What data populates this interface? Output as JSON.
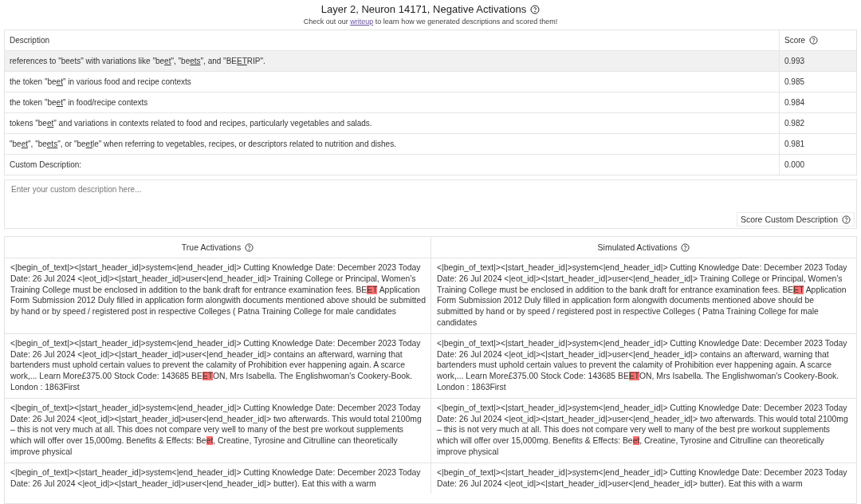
{
  "header": {
    "title": "Layer 2, Neuron 14171, Negative Activations",
    "subtitle_before": "Check out our",
    "subtitle_link": "writeup",
    "subtitle_after": "to learn how we generated descriptions and scored them!"
  },
  "descriptions": {
    "columns": [
      "Description",
      "Score"
    ],
    "rows": [
      {
        "selected": true,
        "score": "0.993",
        "parts": [
          {
            "text": "references to \"beets\" with variations like \"be",
            "underlined": false
          },
          {
            "text": "et",
            "underlined": true
          },
          {
            "text": "\", \"be",
            "underlined": false
          },
          {
            "text": "ets",
            "underlined": true
          },
          {
            "text": "\", and \"BE",
            "underlined": false
          },
          {
            "text": "ET",
            "underlined": true
          },
          {
            "text": "RIP\".",
            "underlined": false
          }
        ]
      },
      {
        "selected": false,
        "score": "0.985",
        "parts": [
          {
            "text": "the token \"be",
            "underlined": false
          },
          {
            "text": "et",
            "underlined": true
          },
          {
            "text": "\" in various food and recipe contexts",
            "underlined": false
          }
        ]
      },
      {
        "selected": false,
        "score": "0.984",
        "parts": [
          {
            "text": "the token \"be",
            "underlined": false
          },
          {
            "text": "et",
            "underlined": true
          },
          {
            "text": "\" in food/recipe contexts",
            "underlined": false
          }
        ]
      },
      {
        "selected": false,
        "score": "0.982",
        "parts": [
          {
            "text": "tokens \"be",
            "underlined": false
          },
          {
            "text": "et",
            "underlined": true
          },
          {
            "text": "\" and variations in contexts related to food and recipes, particularly vegetables and salads.",
            "underlined": false
          }
        ]
      },
      {
        "selected": false,
        "score": "0.981",
        "parts": [
          {
            "text": "\"be",
            "underlined": false
          },
          {
            "text": "et",
            "underlined": true
          },
          {
            "text": "\", \"be",
            "underlined": false
          },
          {
            "text": "ets",
            "underlined": true
          },
          {
            "text": "\", or \"be",
            "underlined": false
          },
          {
            "text": "et",
            "underlined": true
          },
          {
            "text": "le\" when referring to vegetables, recipes, or descriptors related to nutrition and dishes.",
            "underlined": false
          }
        ]
      },
      {
        "selected": false,
        "score": "0.000",
        "parts": [
          {
            "text": "Custom Description:",
            "underlined": false
          }
        ]
      }
    ]
  },
  "custom": {
    "placeholder": "Enter your custom description here...",
    "button": "Score Custom Description"
  },
  "activations": {
    "columns": [
      "True Activations",
      "Simulated Activations"
    ],
    "rows": [
      [
        [
          {
            "text": "<|begin_of_text|><|start_header_id|>system<|end_header_id|> Cutting Knowledge Date: December 2023 Today Date: 26 Jul 2024 <|eot_id|><|start_header_id|>user<|end_header_id|> Training College or Principal, Women’s Training College must be enclosed in addition to the bank draft for entrance examination fees. BE",
            "highlighted": false
          },
          {
            "text": "ET",
            "highlighted": true
          },
          {
            "text": " Application Form Submission 2012 Duly filled in application form alongwith documents mentioned above should be submitted by hand or by speed / registered post in respective Colleges ( Patna Training College for male candidates",
            "highlighted": false
          }
        ],
        [
          {
            "text": "<|begin_of_text|><|start_header_id|>system<|end_header_id|> Cutting Knowledge Date: December 2023 Today Date: 26 Jul 2024 <|eot_id|><|start_header_id|>user<|end_header_id|> Training College or Principal, Women’s Training College must be enclosed in addition to the bank draft for entrance examination fees. BE",
            "highlighted": false
          },
          {
            "text": "ET",
            "highlighted": true
          },
          {
            "text": " Application Form Submission 2012 Duly filled in application form alongwith documents mentioned above should be submitted by hand or by speed / registered post in respective Colleges ( Patna Training College for male candidates",
            "highlighted": false
          }
        ]
      ],
      [
        [
          {
            "text": "<|begin_of_text|><|start_header_id|>system<|end_header_id|> Cutting Knowledge Date: December 2023 Today Date: 26 Jul 2024 <|eot_id|><|start_header_id|>user<|end_header_id|> contains an afterward, warning that bartenders must uphold certain values to prevent the calamity of Prohibition ever happening again. A scarce work,... Learn More£375.00 Stock Code: 143685 BE",
            "highlighted": false
          },
          {
            "text": "ET",
            "highlighted": true
          },
          {
            "text": "ON, Mrs Isabella. The Englishwoman's Cookery-Book. London : 1863First",
            "highlighted": false
          }
        ],
        [
          {
            "text": "<|begin_of_text|><|start_header_id|>system<|end_header_id|> Cutting Knowledge Date: December 2023 Today Date: 26 Jul 2024 <|eot_id|><|start_header_id|>user<|end_header_id|> contains an afterward, warning that bartenders must uphold certain values to prevent the calamity of Prohibition ever happening again. A scarce work,... Learn More£375.00 Stock Code: 143685 BE",
            "highlighted": false
          },
          {
            "text": "ET",
            "highlighted": true
          },
          {
            "text": "ON, Mrs Isabella. The Englishwoman's Cookery-Book. London : 1863First",
            "highlighted": false
          }
        ]
      ],
      [
        [
          {
            "text": "<|begin_of_text|><|start_header_id|>system<|end_header_id|> Cutting Knowledge Date: December 2023 Today Date: 26 Jul 2024 <|eot_id|><|start_header_id|>user<|end_header_id|> two afterwards. This would total 2100mg – this is not very much at all. This does not compare very well to many of the best pre workout supplements which will offer over 15,000mg. Benefits & Effects: Be",
            "highlighted": false
          },
          {
            "text": "et",
            "highlighted": true
          },
          {
            "text": ", Creatine, Tyrosine and Citrulline can theoretically improve physical",
            "highlighted": false
          }
        ],
        [
          {
            "text": "<|begin_of_text|><|start_header_id|>system<|end_header_id|> Cutting Knowledge Date: December 2023 Today Date: 26 Jul 2024 <|eot_id|><|start_header_id|>user<|end_header_id|> two afterwards. This would total 2100mg – this is not very much at all. This does not compare very well to many of the best pre workout supplements which will offer over 15,000mg. Benefits & Effects: Be",
            "highlighted": false
          },
          {
            "text": "et",
            "highlighted": true
          },
          {
            "text": ", Creatine, Tyrosine and Citrulline can theoretically improve physical",
            "highlighted": false
          }
        ]
      ],
      [
        [
          {
            "text": "<|begin_of_text|><|start_header_id|>system<|end_header_id|> Cutting Knowledge Date: December 2023 Today Date: 26 Jul 2024 <|eot_id|><|start_header_id|>user<|end_header_id|> butter). Eat this with a warm",
            "highlighted": false
          }
        ],
        [
          {
            "text": "<|begin_of_text|><|start_header_id|>system<|end_header_id|> Cutting Knowledge Date: December 2023 Today Date: 26 Jul 2024 <|eot_id|><|start_header_id|>user<|end_header_id|> butter). Eat this with a warm",
            "highlighted": false
          }
        ]
      ]
    ]
  }
}
